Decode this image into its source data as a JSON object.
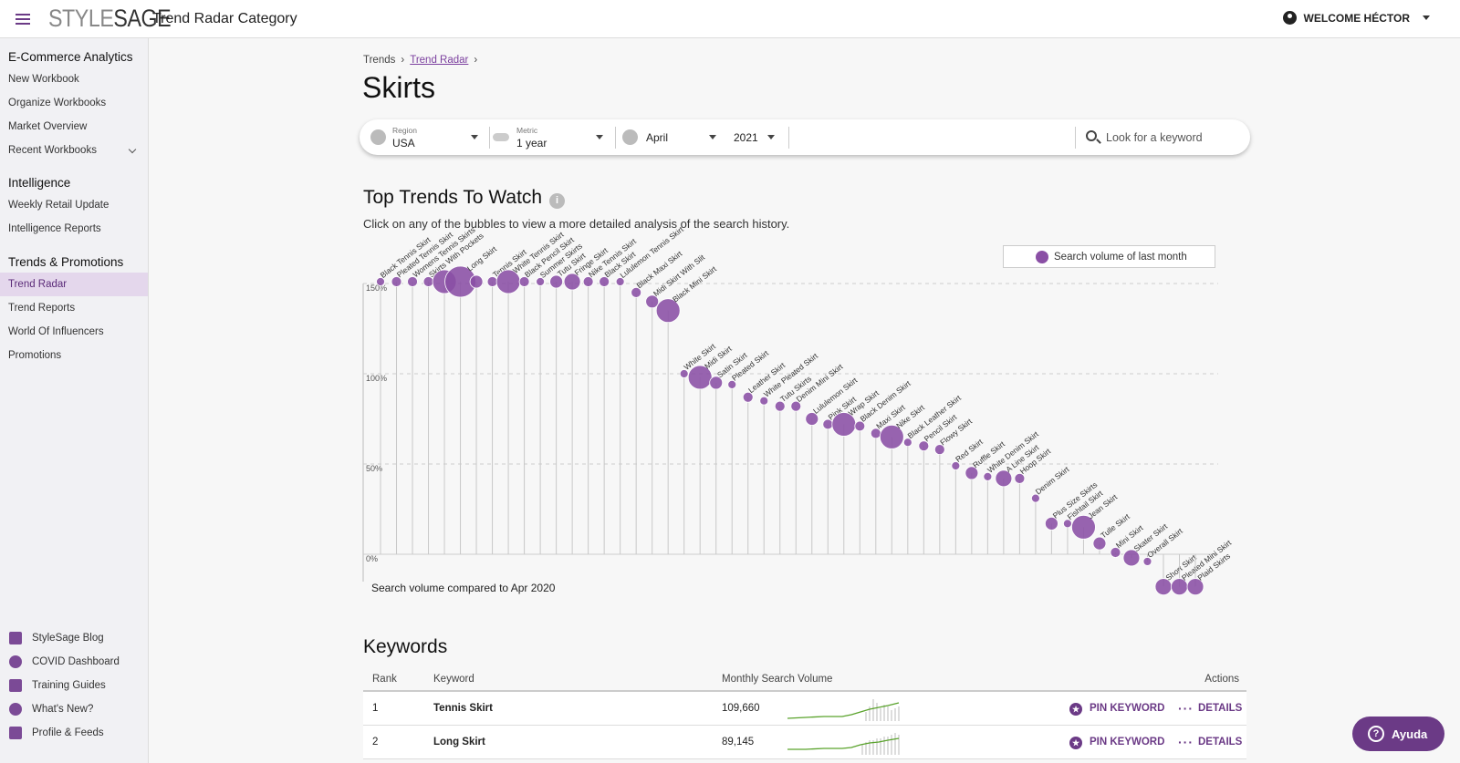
{
  "header": {
    "logo_prefix": "STYLE",
    "logo_suffix": "SAGE",
    "title": "Trend Radar Category",
    "welcome": "WELCOME HÉCTOR"
  },
  "sidebar": {
    "sections": [
      {
        "heading": "E-Commerce Analytics",
        "items": [
          "New Workbook",
          "Organize Workbooks",
          "Market Overview",
          "Recent Workbooks"
        ]
      },
      {
        "heading": "Intelligence",
        "items": [
          "Weekly Retail Update",
          "Intelligence Reports"
        ]
      },
      {
        "heading": "Trends & Promotions",
        "items": [
          "Trend Radar",
          "Trend Reports",
          "World Of Influencers",
          "Promotions"
        ]
      }
    ],
    "active_item": "Trend Radar",
    "bottom_items": [
      "StyleSage Blog",
      "COVID Dashboard",
      "Training Guides",
      "What's New?",
      "Profile & Feeds"
    ]
  },
  "breadcrumb": {
    "root": "Trends",
    "current": "Trend Radar"
  },
  "page_title": "Skirts",
  "filters": {
    "region_label": "Region",
    "region_value": "USA",
    "metric_label": "Metric",
    "metric_value": "1 year",
    "month_value": "April",
    "year_value": "2021",
    "search_placeholder": "Look for a keyword"
  },
  "trends_section": {
    "title": "Top Trends To Watch",
    "subtitle": "Click on any of the bubbles to view a more detailed analysis of the search history.",
    "legend": "Search volume of last month",
    "caption": "Search volume compared to Apr 2020"
  },
  "chart_data": {
    "type": "scatter",
    "description_fields": [
      "keyword",
      "growth_pct",
      "volume_size"
    ],
    "y_ticks": [
      "0%",
      "50%",
      "100%",
      "150%"
    ],
    "ylim": [
      -17,
      156
    ],
    "color": "#8a4fa5",
    "points": [
      {
        "label": "Black Tennis Skirt",
        "y": 151,
        "s": 1
      },
      {
        "label": "Pleated Tennis Skirt",
        "y": 151,
        "s": 2
      },
      {
        "label": "Womens Tennis Skirts",
        "y": 151,
        "s": 2
      },
      {
        "label": "Skirts With Pockets",
        "y": 151,
        "s": 2
      },
      {
        "label": "",
        "y": 151,
        "s": 5
      },
      {
        "label": "Long Skirt",
        "y": 151,
        "s": 6
      },
      {
        "label": "",
        "y": 151,
        "s": 3
      },
      {
        "label": "Tennis Skirt",
        "y": 151,
        "s": 2
      },
      {
        "label": "White Tennis Skirt",
        "y": 151,
        "s": 5
      },
      {
        "label": "Black Pencil Skirt",
        "y": 151,
        "s": 2
      },
      {
        "label": "Summer Skirts",
        "y": 151,
        "s": 1
      },
      {
        "label": "Tutu Skirt",
        "y": 151,
        "s": 3
      },
      {
        "label": "Fringe Skirt",
        "y": 151,
        "s": 4
      },
      {
        "label": "Nike Tennis Skirt",
        "y": 151,
        "s": 2
      },
      {
        "label": "Black Skirt",
        "y": 151,
        "s": 2
      },
      {
        "label": "Lululemon Tennis Skirt",
        "y": 151,
        "s": 1
      },
      {
        "label": "Black Maxi Skirt",
        "y": 145,
        "s": 2
      },
      {
        "label": "Midi Skirt With Slit",
        "y": 140,
        "s": 3
      },
      {
        "label": "Black Mini Skirt",
        "y": 135,
        "s": 5
      },
      {
        "label": "White Skirt",
        "y": 100,
        "s": 1
      },
      {
        "label": "Midi Skirt",
        "y": 98,
        "s": 5
      },
      {
        "label": "Satin Skirt",
        "y": 95,
        "s": 3
      },
      {
        "label": "Pleated Skirt",
        "y": 94,
        "s": 1
      },
      {
        "label": "Leather Skirt",
        "y": 87,
        "s": 2
      },
      {
        "label": "White Pleated Skirt",
        "y": 85,
        "s": 1
      },
      {
        "label": "Tutu Skirts",
        "y": 82,
        "s": 2
      },
      {
        "label": "Denim Mini Skirt",
        "y": 82,
        "s": 2
      },
      {
        "label": "Lululemon Skirt",
        "y": 75,
        "s": 3
      },
      {
        "label": "Pink Skirt",
        "y": 72,
        "s": 2
      },
      {
        "label": "Wrap Skirt",
        "y": 72,
        "s": 5
      },
      {
        "label": "Black Denim Skirt",
        "y": 71,
        "s": 2
      },
      {
        "label": "Maxi Skirt",
        "y": 67,
        "s": 2
      },
      {
        "label": "Nike Skirt",
        "y": 65,
        "s": 5
      },
      {
        "label": "Black Leather Skirt",
        "y": 62,
        "s": 1
      },
      {
        "label": "Pencil Skirt",
        "y": 60,
        "s": 2
      },
      {
        "label": "Flowy Skirt",
        "y": 58,
        "s": 2
      },
      {
        "label": "Red Skirt",
        "y": 49,
        "s": 1
      },
      {
        "label": "Ruffle Skirt",
        "y": 45,
        "s": 3
      },
      {
        "label": "White Denim Skirt",
        "y": 43,
        "s": 1
      },
      {
        "label": "A Line Skirt",
        "y": 42,
        "s": 4
      },
      {
        "label": "Hoop Skirt",
        "y": 42,
        "s": 2
      },
      {
        "label": "Denim Skirt",
        "y": 31,
        "s": 1
      },
      {
        "label": "Plus Size Skirts",
        "y": 17,
        "s": 3
      },
      {
        "label": "Fishtail Skirt",
        "y": 17,
        "s": 1
      },
      {
        "label": "Jean Skirt",
        "y": 15,
        "s": 5
      },
      {
        "label": "Tulle Skirt",
        "y": 6,
        "s": 3
      },
      {
        "label": "Mini Skirt",
        "y": 1,
        "s": 2
      },
      {
        "label": "Skater Skirt",
        "y": -2,
        "s": 4
      },
      {
        "label": "Overall Skirt",
        "y": -4,
        "s": 1
      },
      {
        "label": "Short Skirt",
        "y": -18,
        "s": 4
      },
      {
        "label": "Pleated Mini Skirt",
        "y": -18,
        "s": 4
      },
      {
        "label": "Plaid Skirts",
        "y": -18,
        "s": 4
      }
    ]
  },
  "keywords": {
    "title": "Keywords",
    "columns": [
      "Rank",
      "Keyword",
      "Monthly Search Volume",
      "Actions"
    ],
    "rows": [
      {
        "rank": "1",
        "keyword": "Tennis Skirt",
        "volume": "109,660"
      },
      {
        "rank": "2",
        "keyword": "Long Skirt",
        "volume": "89,145"
      }
    ],
    "pin_label": "PIN KEYWORD",
    "details_label": "DETAILS"
  },
  "help_button": "Ayuda"
}
